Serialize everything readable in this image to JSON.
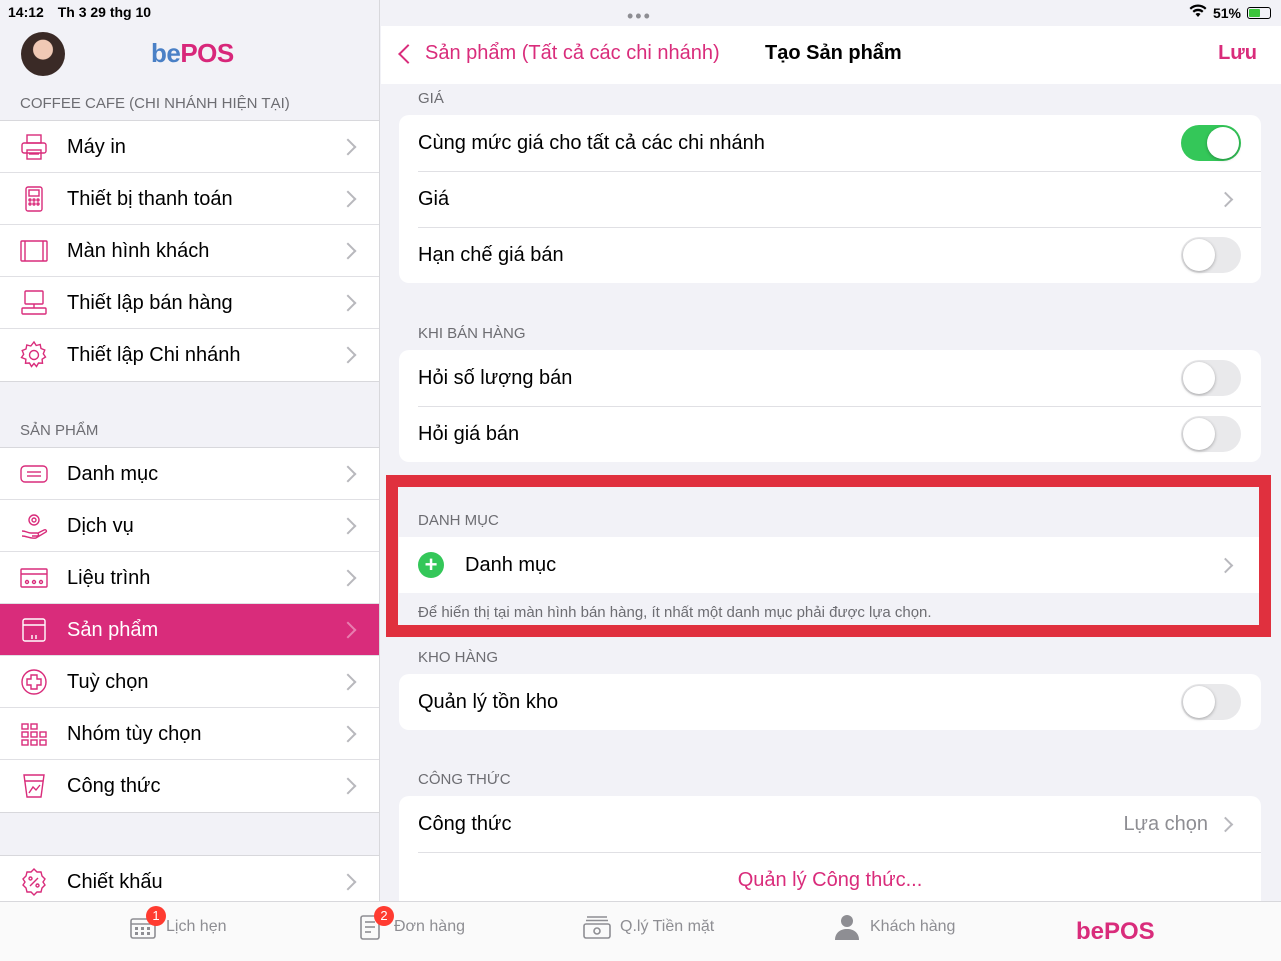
{
  "status": {
    "time": "14:12",
    "date": "Th 3 29 thg 10",
    "battery": "51%"
  },
  "brand": {
    "logo_be": "be",
    "logo_pos": "POS"
  },
  "sidebar": {
    "section1": "COFFEE CAFE (CHI NHÁNH HIỆN TẠI)",
    "items1": [
      {
        "label": "Máy in",
        "icon": "printer-icon"
      },
      {
        "label": "Thiết bị thanh toán",
        "icon": "payment-terminal-icon"
      },
      {
        "label": "Màn hình khách",
        "icon": "customer-display-icon"
      },
      {
        "label": "Thiết lập bán hàng",
        "icon": "pos-setup-icon"
      },
      {
        "label": "Thiết lập Chi nhánh",
        "icon": "gear-icon"
      }
    ],
    "section2": "SẢN PHẨM",
    "items2": [
      {
        "label": "Danh mục",
        "icon": "category-icon"
      },
      {
        "label": "Dịch vụ",
        "icon": "service-icon"
      },
      {
        "label": "Liệu trình",
        "icon": "treatment-icon"
      },
      {
        "label": "Sản phẩm",
        "icon": "product-icon",
        "active": true
      },
      {
        "label": "Tuỳ chọn",
        "icon": "option-icon"
      },
      {
        "label": "Nhóm tùy chọn",
        "icon": "option-group-icon"
      },
      {
        "label": "Công thức",
        "icon": "recipe-icon"
      }
    ],
    "items3": [
      {
        "label": "Chiết khấu",
        "icon": "discount-icon"
      }
    ]
  },
  "nav": {
    "back_label": "Sản phẩm (Tất cả các chi nhánh)",
    "title": "Tạo Sản phẩm",
    "save": "Lưu"
  },
  "groups": {
    "price": {
      "label": "GIÁ",
      "same_price": "Cùng mức giá cho tất cả các chi nhánh",
      "same_price_on": true,
      "price": "Giá",
      "restrict": "Hạn chế giá bán",
      "restrict_on": false
    },
    "selling": {
      "label": "KHI BÁN HÀNG",
      "ask_qty": "Hỏi số lượng bán",
      "ask_price": "Hỏi giá bán"
    },
    "category": {
      "label": "DANH MỤC",
      "row": "Danh mục",
      "note": "Để hiển thị tại màn hình bán hàng, ít nhất một danh mục phải được lựa chọn."
    },
    "stock": {
      "label": "KHO HÀNG",
      "manage": "Quản lý tồn kho"
    },
    "recipe": {
      "label": "CÔNG THỨC",
      "row": "Công thức",
      "value": "Lựa chọn",
      "manage_link": "Quản lý Công thức..."
    }
  },
  "tabbar": {
    "tabs": [
      {
        "label": "Lịch hẹn",
        "badge": "1",
        "icon": "calendar-icon"
      },
      {
        "label": "Đơn hàng",
        "badge": "2",
        "icon": "order-icon"
      },
      {
        "label": "Q.lý Tiền mặt",
        "icon": "cash-register-icon"
      },
      {
        "label": "Khách hàng",
        "icon": "customer-icon"
      }
    ],
    "logo": "bePOS"
  }
}
